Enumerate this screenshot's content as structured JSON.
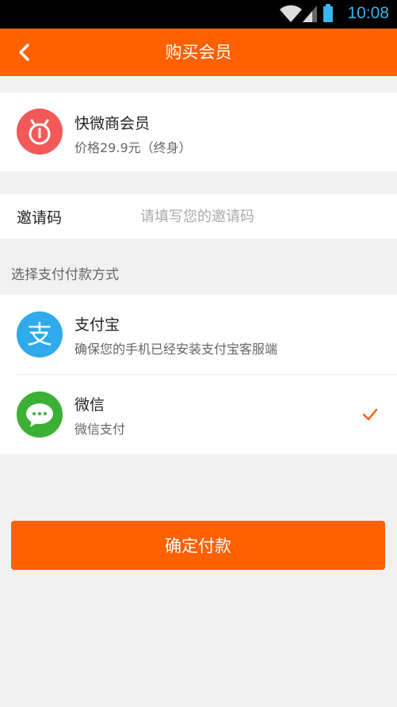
{
  "status_bar": {
    "time": "10:08"
  },
  "header": {
    "title": "购买会员"
  },
  "product": {
    "name": "快微商会员",
    "price": "价格29.9元（终身）"
  },
  "invite": {
    "label": "邀请码",
    "placeholder": "请填写您的邀请码",
    "value": ""
  },
  "payment": {
    "section_label": "选择支付付款方式",
    "methods": [
      {
        "name": "支付宝",
        "desc": "确保您的手机已经安装支付宝客服端",
        "selected": false
      },
      {
        "name": "微信",
        "desc": "微信支付",
        "selected": true
      }
    ]
  },
  "confirm_label": "确定付款",
  "colors": {
    "accent": "#ff6000",
    "alipay": "#2faaec",
    "wechat": "#3cb034",
    "product_logo": "#f25a5a",
    "status_time": "#3ab4ec"
  }
}
